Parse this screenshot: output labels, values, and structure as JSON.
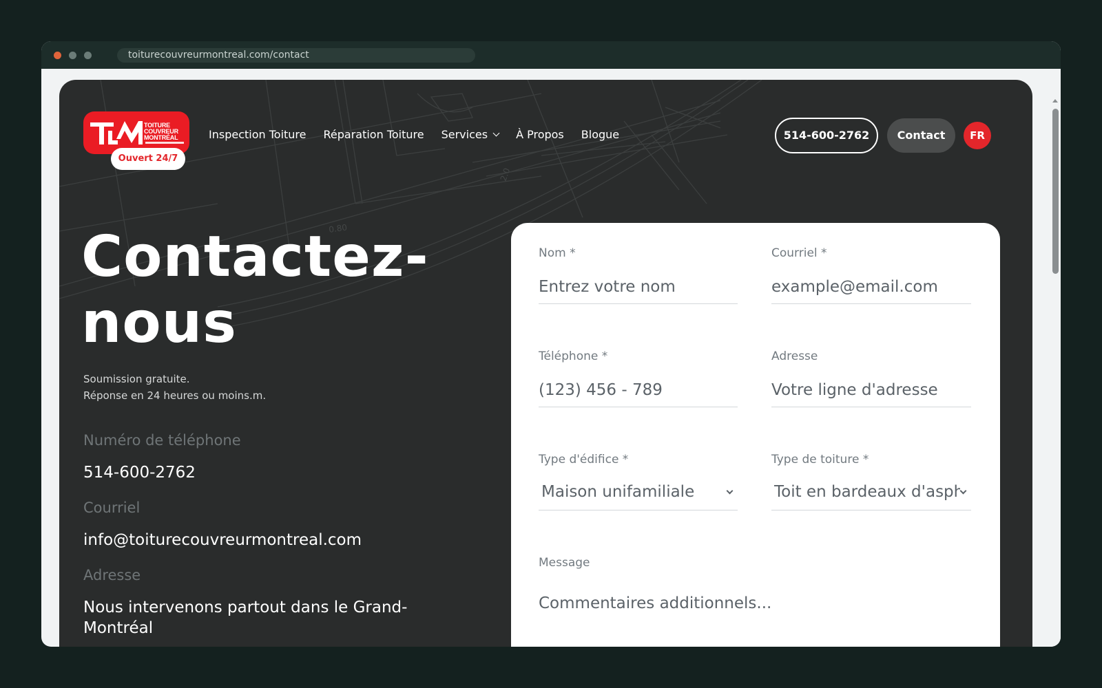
{
  "browser": {
    "url": "toiturecouvreurmontreal.com/contact"
  },
  "header": {
    "logo_lines": [
      "TOITURE",
      "COUVREUR",
      "MONTRÉAL"
    ],
    "open_badge": "Ouvert 24/7",
    "nav": [
      {
        "label": "Inspection Toiture"
      },
      {
        "label": "Réparation Toiture"
      },
      {
        "label": "Services",
        "icon": "chevron-down-icon"
      },
      {
        "label": "À Propos"
      },
      {
        "label": "Blogue"
      }
    ],
    "phone_button": "514-600-2762",
    "contact_button": "Contact",
    "language_button": "FR"
  },
  "hero": {
    "title_line1": "Contactez-",
    "title_line2": "nous",
    "subtitle_line1": "Soumission gratuite.",
    "subtitle_line2": "Réponse en 24 heures ou moins.m."
  },
  "contact_info": {
    "phone_label": "Numéro de téléphone",
    "phone_value": "514-600-2762",
    "email_label": "Courriel",
    "email_value": "info@toiturecouvreurmontreal.com",
    "address_label": "Adresse",
    "address_value": "Nous intervenons partout dans le Grand-Montréal"
  },
  "form": {
    "name": {
      "label": "Nom *",
      "placeholder": "Entrez votre nom"
    },
    "email": {
      "label": "Courriel *",
      "placeholder": "example@email.com"
    },
    "phone": {
      "label": "Téléphone *",
      "placeholder": "(123) 456 - 789"
    },
    "address": {
      "label": "Adresse",
      "placeholder": "Votre ligne d'adresse"
    },
    "building_type": {
      "label": "Type d'édifice *",
      "value": "Maison unifamiliale"
    },
    "roof_type": {
      "label": "Type de toiture *",
      "value": "Toit en bardeaux d'asphalte"
    },
    "message": {
      "label": "Message",
      "placeholder": "Commentaires additionnels..."
    }
  },
  "colors": {
    "brand_red": "#ea1c24",
    "page_background": "#2a2c2c",
    "card_background": "#ffffff"
  }
}
